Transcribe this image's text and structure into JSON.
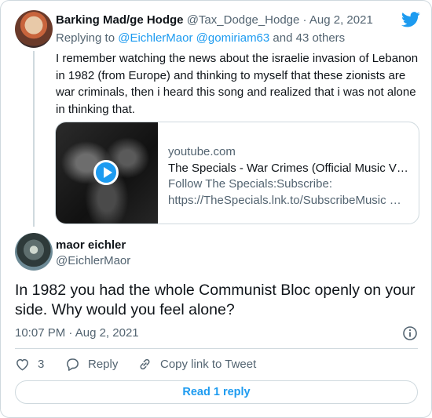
{
  "tweet1": {
    "author_name": "Barking Mad/ge Hodge",
    "author_handle": "@Tax_Dodge_Hodge",
    "separator": "·",
    "date": "Aug 2, 2021",
    "replying_prefix": "Replying to ",
    "replying_mention1": "@EichlerMaor",
    "replying_mention2": "@gomiriam63",
    "replying_suffix": " and 43 others",
    "text": "I remember watching the news about the israelie invasion of Lebanon in 1982 (from Europe) and thinking to myself that these zionists are war criminals, then i heard this song and realized that i was not alone in thinking that.",
    "link_card": {
      "domain": "youtube.com",
      "title": "The Specials - War Crimes (Official Music V…",
      "description_line1": "Follow The Specials:Subscribe:",
      "description_line2": "https://TheSpecials.lnk.to/SubscribeMusic …"
    }
  },
  "tweet2": {
    "author_name": "maor eichler",
    "author_handle": "@EichlerMaor",
    "text": "In 1982 you had the whole Communist Bloc openly on your side. Why would you feel alone?",
    "time": "10:07 PM",
    "separator": "·",
    "date": "Aug 2, 2021"
  },
  "actions": {
    "like_count": "3",
    "reply_label": "Reply",
    "copy_link_label": "Copy link to Tweet"
  },
  "read_replies_label": "Read 1 reply",
  "icons": {
    "brand": "twitter-bird-icon",
    "info": "info-icon",
    "like": "heart-icon",
    "reply": "reply-bubble-icon",
    "copy": "link-icon",
    "play": "play-icon"
  },
  "colors": {
    "accent": "#1d9bf0",
    "muted": "#536471",
    "text": "#0f1419",
    "border": "#cfd9de"
  }
}
